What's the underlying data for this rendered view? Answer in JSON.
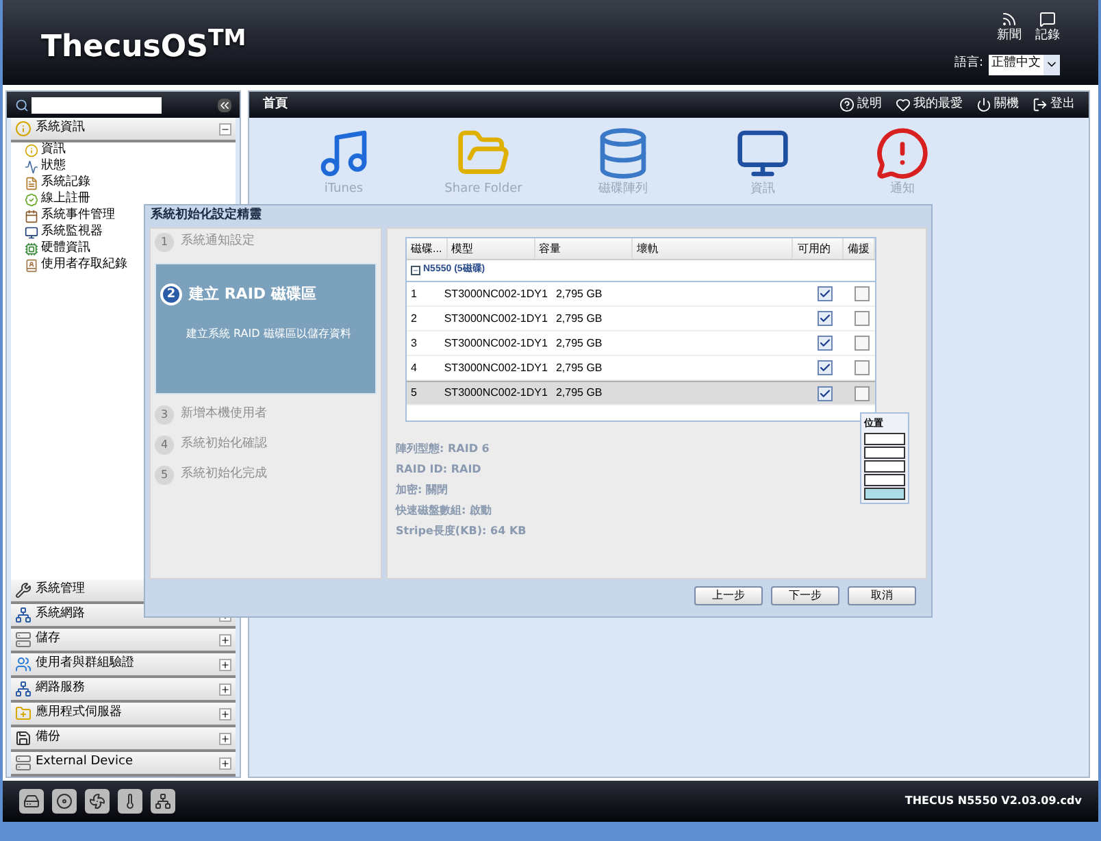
{
  "header": {
    "logo": "ThecusOS$^{TM}$",
    "links": [
      {
        "kind": "news",
        "label": "新聞"
      },
      {
        "kind": "log",
        "label": "記錄"
      }
    ],
    "language_label": "語言:",
    "language_value": "正體中文"
  },
  "sidebar": {
    "sections": [
      {
        "kind": "info",
        "label": "系統資訊",
        "expanded": true,
        "children": [
          {
            "kind": "info",
            "label": "資訊"
          },
          {
            "kind": "status",
            "label": "狀態"
          },
          {
            "kind": "log",
            "label": "系統記錄"
          },
          {
            "kind": "register",
            "label": "線上註冊"
          },
          {
            "kind": "event",
            "label": "系統事件管理"
          },
          {
            "kind": "monitor",
            "label": "系統監視器"
          },
          {
            "kind": "hardware",
            "label": "硬體資訊"
          },
          {
            "kind": "access",
            "label": "使用者存取紀錄"
          }
        ]
      },
      {
        "kind": "tools",
        "label": "系統管理",
        "expanded": false
      },
      {
        "kind": "network",
        "label": "系統網路",
        "expanded": false
      },
      {
        "kind": "storage",
        "label": "儲存",
        "expanded": false
      },
      {
        "kind": "users",
        "label": "使用者與群組驗證",
        "expanded": false
      },
      {
        "kind": "network",
        "label": "網路服務",
        "expanded": false
      },
      {
        "kind": "folder",
        "label": "應用程式伺服器",
        "expanded": false
      },
      {
        "kind": "backup",
        "label": "備份",
        "expanded": false
      },
      {
        "kind": "storage",
        "label": "External Device",
        "expanded": false
      }
    ]
  },
  "main": {
    "title": "首頁",
    "actions": [
      {
        "kind": "help",
        "label": "說明"
      },
      {
        "kind": "favorite",
        "label": "我的最愛"
      },
      {
        "kind": "power",
        "label": "關機"
      },
      {
        "kind": "logout",
        "label": "登出"
      }
    ],
    "shortcuts": [
      {
        "kind": "music",
        "label": "iTunes"
      },
      {
        "kind": "folder",
        "label": "Share Folder"
      },
      {
        "kind": "raid",
        "label": "磁碟陣列"
      },
      {
        "kind": "info",
        "label": "資訊"
      },
      {
        "kind": "alert",
        "label": "通知"
      }
    ]
  },
  "dialog": {
    "title": "系統初始化設定精靈",
    "steps": [
      {
        "number": "1",
        "label": "系統通知設定",
        "selected": false
      },
      {
        "number": "2",
        "label": "建立 RAID 磁碟區",
        "selected": true,
        "description": "建立系統 RAID 磁碟區以儲存資料"
      },
      {
        "number": "3",
        "label": "新增本機使用者",
        "selected": false
      },
      {
        "number": "4",
        "label": "系統初始化確認",
        "selected": false
      },
      {
        "number": "5",
        "label": "系統初始化完成",
        "selected": false
      }
    ],
    "table": {
      "columns": [
        "磁碟...",
        "模型",
        "容量",
        "壞軌",
        "可用的",
        "備援"
      ],
      "group": "N5550 (5磁碟)",
      "group_expanded": true,
      "rows": [
        {
          "disk": "1",
          "model": "ST3000NC002-1DY1",
          "capacity": "2,795 GB",
          "available": true,
          "spare": false,
          "selected": false
        },
        {
          "disk": "2",
          "model": "ST3000NC002-1DY1",
          "capacity": "2,795 GB",
          "available": true,
          "spare": false,
          "selected": false
        },
        {
          "disk": "3",
          "model": "ST3000NC002-1DY1",
          "capacity": "2,795 GB",
          "available": true,
          "spare": false,
          "selected": false
        },
        {
          "disk": "4",
          "model": "ST3000NC002-1DY1",
          "capacity": "2,795 GB",
          "available": true,
          "spare": false,
          "selected": false
        },
        {
          "disk": "5",
          "model": "ST3000NC002-1DY1",
          "capacity": "2,795 GB",
          "available": true,
          "spare": false,
          "selected": true
        }
      ]
    },
    "position": {
      "title": "位置",
      "slots": [
        {
          "selected": false
        },
        {
          "selected": false
        },
        {
          "selected": false
        },
        {
          "selected": false
        },
        {
          "selected": true
        }
      ]
    },
    "summary": [
      "陣列型態: RAID 6",
      "RAID ID: RAID",
      "加密: 關閉",
      "快速磁盤數組: 啟動",
      "Stripe長度(KB): 64 KB"
    ],
    "buttons": [
      "上一步",
      "下一步",
      "取消"
    ]
  },
  "footer": {
    "version": "THECUS N5550 V2.03.09.cdv"
  }
}
